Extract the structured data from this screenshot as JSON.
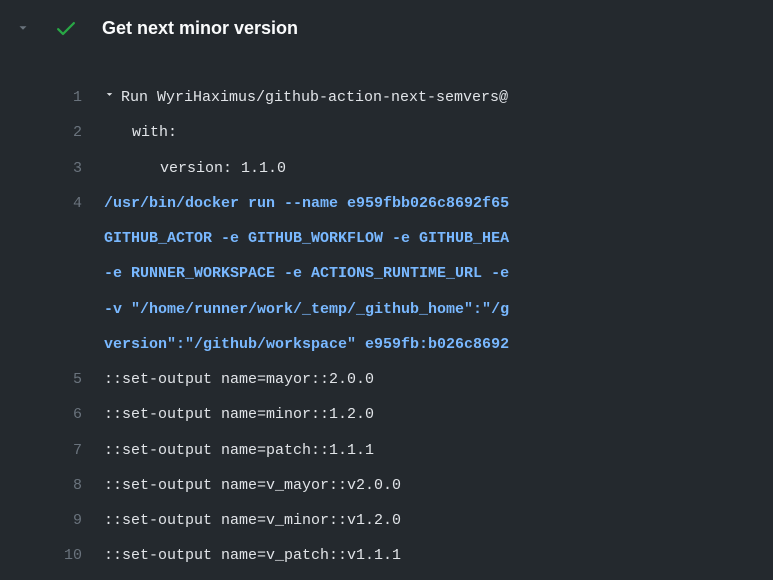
{
  "header": {
    "title": "Get next minor version",
    "status": "success"
  },
  "log": {
    "lines": [
      {
        "num": "1",
        "type": "run",
        "text": "Run WyriHaximus/github-action-next-semvers@"
      },
      {
        "num": "2",
        "type": "plain-indent1",
        "text": "with:"
      },
      {
        "num": "3",
        "type": "plain-indent2",
        "text": "version: 1.1.0"
      },
      {
        "num": "4",
        "type": "cmd",
        "text": "/usr/bin/docker run --name e959fbb026c8692f65"
      },
      {
        "num": "",
        "type": "cmd",
        "text": "GITHUB_ACTOR -e GITHUB_WORKFLOW -e GITHUB_HEA"
      },
      {
        "num": "",
        "type": "cmd",
        "text": "-e RUNNER_WORKSPACE -e ACTIONS_RUNTIME_URL -e"
      },
      {
        "num": "",
        "type": "cmd",
        "text": "-v \"/home/runner/work/_temp/_github_home\":\"/g"
      },
      {
        "num": "",
        "type": "cmd",
        "text": "version\":\"/github/workspace\" e959fb:b026c8692"
      },
      {
        "num": "5",
        "type": "plain",
        "text": "::set-output name=mayor::2.0.0"
      },
      {
        "num": "6",
        "type": "plain",
        "text": "::set-output name=minor::1.2.0"
      },
      {
        "num": "7",
        "type": "plain",
        "text": "::set-output name=patch::1.1.1"
      },
      {
        "num": "8",
        "type": "plain",
        "text": "::set-output name=v_mayor::v2.0.0"
      },
      {
        "num": "9",
        "type": "plain",
        "text": "::set-output name=v_minor::v1.2.0"
      },
      {
        "num": "10",
        "type": "plain",
        "text": "::set-output name=v_patch::v1.1.1"
      }
    ]
  }
}
